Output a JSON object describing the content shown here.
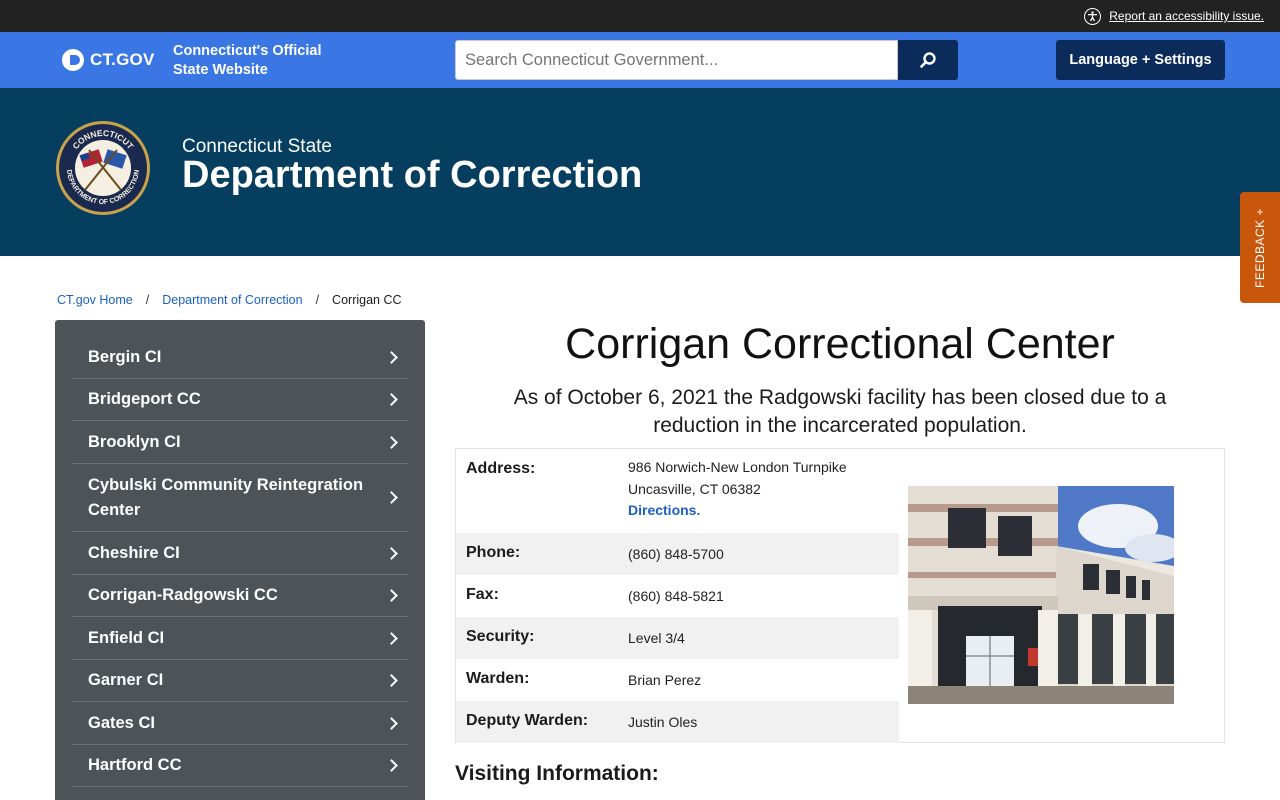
{
  "utility": {
    "accessibility_link": "Report an accessibility issue."
  },
  "ctgov": {
    "logo_text": "CT.GOV",
    "tagline": "Connecticut's Official State Website",
    "search_placeholder": "Search Connecticut Government...",
    "language_button": "Language + Settings"
  },
  "agency": {
    "pre_title": "Connecticut State",
    "title": "Department of Correction",
    "seal_text_top": "CONNECTICUT",
    "seal_text_bottom": "DEPARTMENT OF CORRECTION"
  },
  "feedback": {
    "label": "FEEDBACK +"
  },
  "breadcrumb": {
    "home": "CT.gov Home",
    "section": "Department of Correction",
    "current": "Corrigan CC",
    "separator": "/"
  },
  "sidebar": {
    "items": [
      {
        "label": "Bergin CI"
      },
      {
        "label": "Bridgeport CC"
      },
      {
        "label": "Brooklyn CI"
      },
      {
        "label": "Cybulski Community Reintegration Center"
      },
      {
        "label": "Cheshire CI"
      },
      {
        "label": "Corrigan-Radgowski CC"
      },
      {
        "label": "Enfield CI"
      },
      {
        "label": "Garner CI"
      },
      {
        "label": "Gates CI"
      },
      {
        "label": "Hartford CC"
      }
    ]
  },
  "main": {
    "title": "Corrigan Correctional Center",
    "notice": "As of October 6, 2021 the Radgowski facility has been closed due to a reduction in the incarcerated population.",
    "address_label": "Address:",
    "address_line1": "986 Norwich-New London Turnpike",
    "address_line2": "Uncasville, CT 06382",
    "directions": "Directions.",
    "phone_label": "Phone:",
    "phone": "(860) 848-5700",
    "fax_label": "Fax:",
    "fax": "(860) 848-5821",
    "security_label": "Security:",
    "security": "Level 3/4",
    "warden_label": "Warden:",
    "warden": "Brian Perez",
    "deputy_label": "Deputy Warden:",
    "deputy": "Justin Oles",
    "visiting_heading": "Visiting Information:"
  },
  "colors": {
    "utility_bar": "#222222",
    "ctgov_blue": "#3b77e4",
    "navy": "#0b2b5a",
    "agency_banner": "#063e60",
    "sidebar": "#4d5357",
    "feedback": "#c8570c",
    "link": "#1a5fc4"
  },
  "icons": {
    "accessibility": "accessibility-icon",
    "search": "search-icon",
    "chevron": "chevron-right-icon"
  }
}
